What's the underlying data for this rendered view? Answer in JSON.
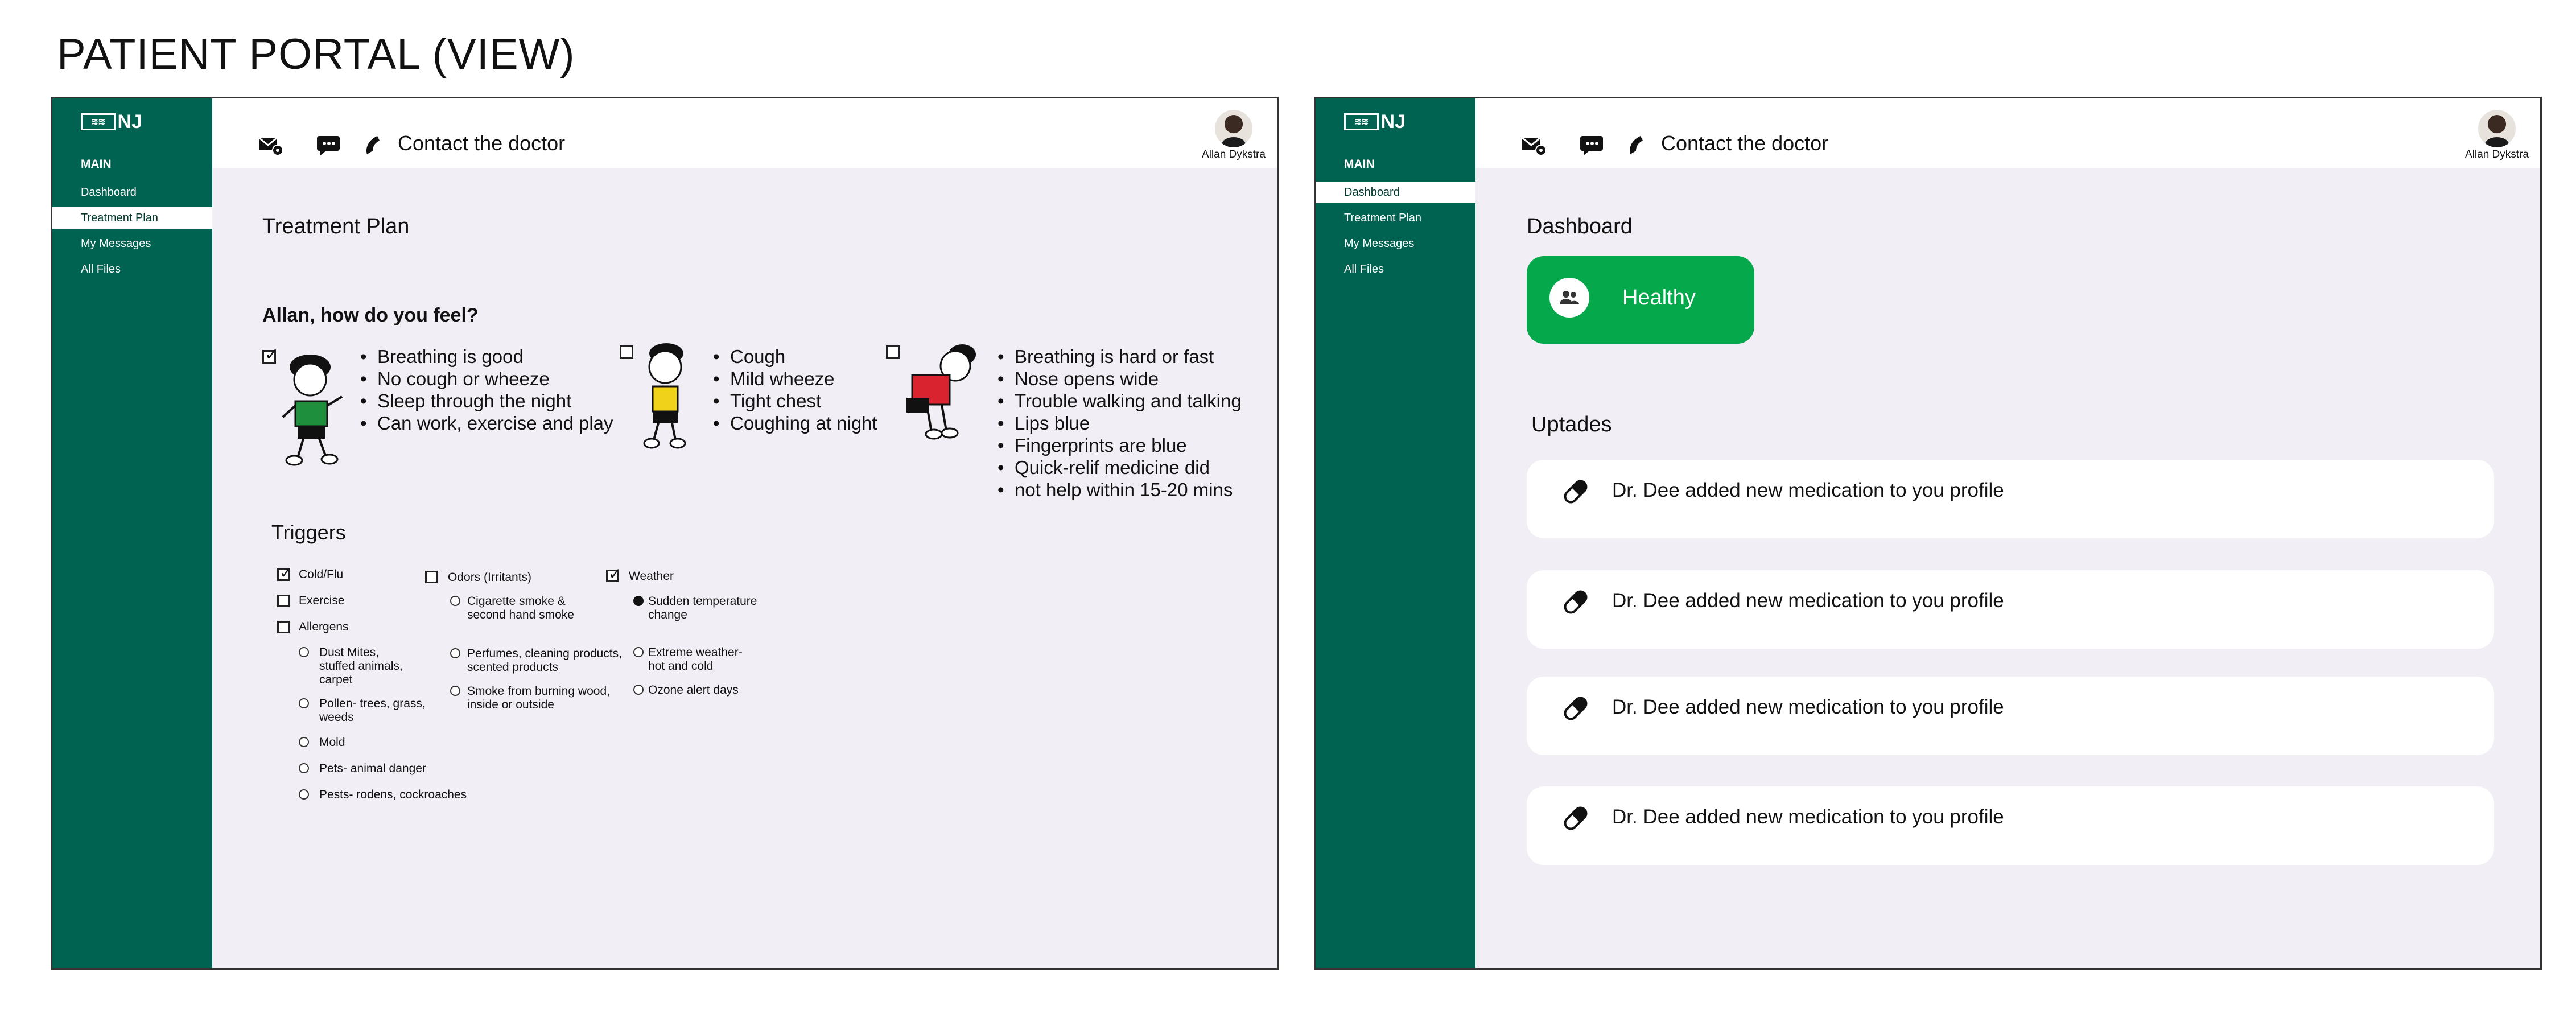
{
  "page": {
    "title": "PATIENT PORTAL (VIEW)"
  },
  "colors": {
    "sidebar": "#006250",
    "content_bg": "#f1eef5",
    "status_green": "#06a84c"
  },
  "common": {
    "logo_text": "NJ",
    "sidebar_section": "MAIN",
    "nav": [
      "Dashboard",
      "Treatment Plan",
      "My Messages",
      "All Files"
    ],
    "topbar_icons": [
      "mail-settings-icon",
      "chat-bubble-icon",
      "phone-icon"
    ],
    "contact_label": "Contact the doctor",
    "user_name": "Allan Dykstra"
  },
  "left_screen": {
    "active_nav": "Treatment Plan",
    "heading": "Treatment Plan",
    "question": "Allan, how do you feel?",
    "zones": [
      {
        "checked": true,
        "figure": "green-zone-figure",
        "items": [
          "Breathing is good",
          "No cough or wheeze",
          "Sleep through the night",
          "Can work, exercise and play"
        ]
      },
      {
        "checked": false,
        "figure": "yellow-zone-figure",
        "items": [
          "Cough",
          "Mild wheeze",
          "Tight chest",
          "Coughing at night"
        ]
      },
      {
        "checked": false,
        "figure": "red-zone-figure",
        "items": [
          "Breathing is hard or fast",
          "Nose opens wide",
          "Trouble walking and talking",
          "Lips blue",
          "Fingerprints are blue",
          "Quick-relif medicine did",
          "not help within 15-20 mins"
        ]
      }
    ],
    "triggers": {
      "title": "Triggers",
      "col1": {
        "checks": [
          {
            "label": "Cold/Flu",
            "checked": true
          },
          {
            "label": "Exercise",
            "checked": false
          },
          {
            "label": "Allergens",
            "checked": false
          }
        ],
        "options": [
          {
            "label": "Dust Mites,\nstuffed animals,\ncarpet",
            "selected": false
          },
          {
            "label": "Pollen- trees, grass,\nweeds",
            "selected": false
          },
          {
            "label": "Mold",
            "selected": false
          },
          {
            "label": "Pets- animal danger",
            "selected": false
          },
          {
            "label": "Pests- rodens, cockroaches",
            "selected": false
          }
        ]
      },
      "col2": {
        "check": {
          "label": "Odors (Irritants)",
          "checked": false
        },
        "options": [
          {
            "label": "Cigarette smoke &\nsecond hand smoke",
            "selected": false
          },
          {
            "label": "Perfumes, cleaning products,\nscented products",
            "selected": false
          },
          {
            "label": "Smoke from burning wood,\ninside or outside",
            "selected": false
          }
        ]
      },
      "col3": {
        "check": {
          "label": "Weather",
          "checked": true
        },
        "options": [
          {
            "label": "Sudden temperature\nchange",
            "selected": true
          },
          {
            "label": "Extreme weather-\nhot and cold",
            "selected": false
          },
          {
            "label": "Ozone alert days",
            "selected": false
          }
        ]
      }
    }
  },
  "right_screen": {
    "active_nav": "Dashboard",
    "heading": "Dashboard",
    "status": {
      "label": "Healthy",
      "icon": "people-icon"
    },
    "updates_title": "Uptades",
    "updates": [
      {
        "icon": "pill-icon",
        "text": "Dr. Dee added new medication to you profile"
      },
      {
        "icon": "pill-icon",
        "text": "Dr. Dee added new medication to you profile"
      },
      {
        "icon": "pill-icon",
        "text": "Dr. Dee added new medication to you profile"
      },
      {
        "icon": "pill-icon",
        "text": "Dr. Dee added new medication to you profile"
      }
    ]
  }
}
